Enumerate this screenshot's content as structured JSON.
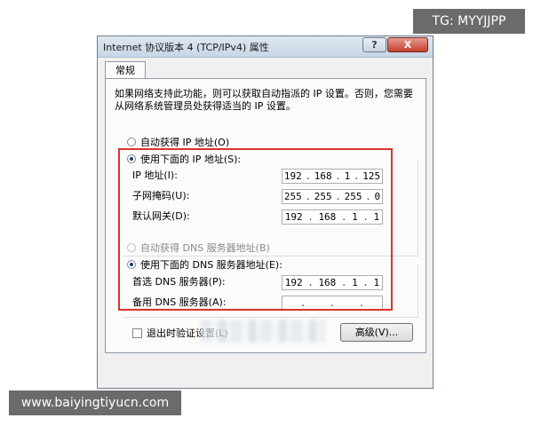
{
  "window": {
    "title": "Internet 协议版本 4 (TCP/IPv4) 属性",
    "help_label": "?",
    "close_label": "X"
  },
  "tabs": [
    {
      "label": "常规"
    }
  ],
  "description": "如果网络支持此功能，则可以获取自动指派的 IP 设置。否则，您需要从网络系统管理员处获得适当的 IP 设置。",
  "ip_section": {
    "auto_label": "自动获得 IP 地址(O)",
    "manual_label": "使用下面的 IP 地址(S):",
    "selected": "manual",
    "fields": [
      {
        "label": "IP 地址(I):",
        "octets": [
          "192",
          "168",
          "1",
          "125"
        ]
      },
      {
        "label": "子网掩码(U):",
        "octets": [
          "255",
          "255",
          "255",
          "0"
        ]
      },
      {
        "label": "默认网关(D):",
        "octets": [
          "192",
          "168",
          "1",
          "1"
        ]
      }
    ]
  },
  "dns_section": {
    "auto_label": "自动获得 DNS 服务器地址(B)",
    "manual_label": "使用下面的 DNS 服务器地址(E):",
    "selected": "manual",
    "fields": [
      {
        "label": "首选 DNS 服务器(P):",
        "octets": [
          "192",
          "168",
          "1",
          "1"
        ]
      },
      {
        "label": "备用 DNS 服务器(A):",
        "octets": [
          "",
          "",
          "",
          ""
        ]
      }
    ]
  },
  "validate_on_exit_label": "退出时验证设置(L)",
  "advanced_button_label": "高级(V)...",
  "watermarks": {
    "top_right": "TG: MYYJJPP",
    "bottom_left": "www.baiyingtiyucn.com"
  },
  "colors": {
    "highlight_frame": "#d9342c",
    "close_button": "#c3402e"
  }
}
